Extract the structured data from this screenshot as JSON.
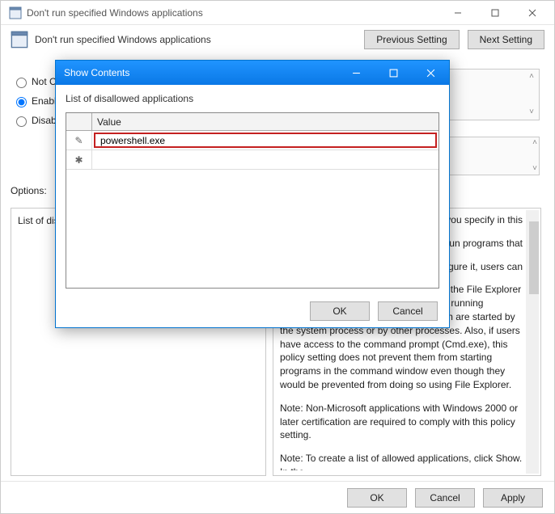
{
  "parent": {
    "title": "Don't run specified Windows applications",
    "subheader_title": "Don't run specified Windows applications",
    "nav": {
      "prev": "Previous Setting",
      "next": "Next Setting"
    },
    "radios": {
      "not_configured": "Not Configured",
      "enabled": "Enabled",
      "disabled": "Disabled",
      "selected": "enabled"
    },
    "options_label": "Options:",
    "options_box_text": "List of disallowed applications",
    "help": {
      "p1_tail": "you specify in this",
      "p2_tail": "un programs that",
      "p3_tail": "igure it, users can",
      "p4": "... running programs that are started by the File Explorer process. It does not prevent users from running programs, such as Task Manager, which are started by the system process or by other processes.  Also, if users have access to the command prompt (Cmd.exe), this policy setting does not prevent them from starting programs in the command window even though they would be prevented from doing so using File Explorer.",
      "p5": "Note: Non-Microsoft applications with Windows 2000 or later certification are required to comply with this policy setting.",
      "p6": "Note: To create a list of allowed applications, click Show.  In the"
    },
    "buttons": {
      "ok": "OK",
      "cancel": "Cancel",
      "apply": "Apply"
    }
  },
  "modal": {
    "title": "Show Contents",
    "caption": "List of disallowed applications",
    "column_header": "Value",
    "rows": [
      {
        "marker": "✎",
        "value": "powershell.exe",
        "editing": true
      },
      {
        "marker": "✱",
        "value": "",
        "editing": false
      }
    ],
    "buttons": {
      "ok": "OK",
      "cancel": "Cancel"
    }
  }
}
